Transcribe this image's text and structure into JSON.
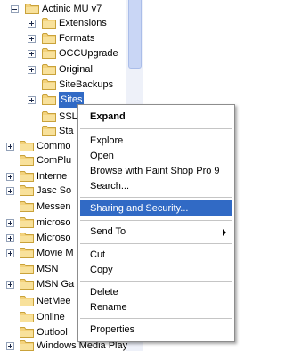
{
  "tree": {
    "items": [
      {
        "label": "Actinic MU v7",
        "expander": "minus"
      },
      {
        "label": "Extensions",
        "expander": "plus"
      },
      {
        "label": "Formats",
        "expander": "plus"
      },
      {
        "label": "OCCUpgrade",
        "expander": "plus"
      },
      {
        "label": "Original",
        "expander": "plus"
      },
      {
        "label": "SiteBackups",
        "expander": ""
      },
      {
        "label": "Sites",
        "expander": "plus"
      },
      {
        "label": "SSL",
        "expander": ""
      },
      {
        "label": "Sta",
        "expander": ""
      },
      {
        "label": "Commo",
        "expander": "plus"
      },
      {
        "label": "ComPlu",
        "expander": ""
      },
      {
        "label": "Interne",
        "expander": "plus"
      },
      {
        "label": "Jasc So",
        "expander": "plus"
      },
      {
        "label": "Messen",
        "expander": ""
      },
      {
        "label": "microso",
        "expander": "plus"
      },
      {
        "label": "Microso",
        "expander": "plus"
      },
      {
        "label": "Movie M",
        "expander": "plus"
      },
      {
        "label": "MSN",
        "expander": ""
      },
      {
        "label": "MSN Ga",
        "expander": "plus"
      },
      {
        "label": "NetMee",
        "expander": ""
      },
      {
        "label": "Online",
        "expander": ""
      },
      {
        "label": "Outlool",
        "expander": ""
      },
      {
        "label": "Windows Media Play",
        "expander": "plus"
      }
    ]
  },
  "context_menu": {
    "expand": "Expand",
    "explore": "Explore",
    "open": "Open",
    "browse_psp": "Browse with Paint Shop Pro 9",
    "search": "Search...",
    "sharing": "Sharing and Security...",
    "send_to": "Send To",
    "cut": "Cut",
    "copy": "Copy",
    "delete": "Delete",
    "rename": "Rename",
    "properties": "Properties"
  },
  "colors": {
    "selection": "#316ac5",
    "folder": "#f3d27c"
  }
}
